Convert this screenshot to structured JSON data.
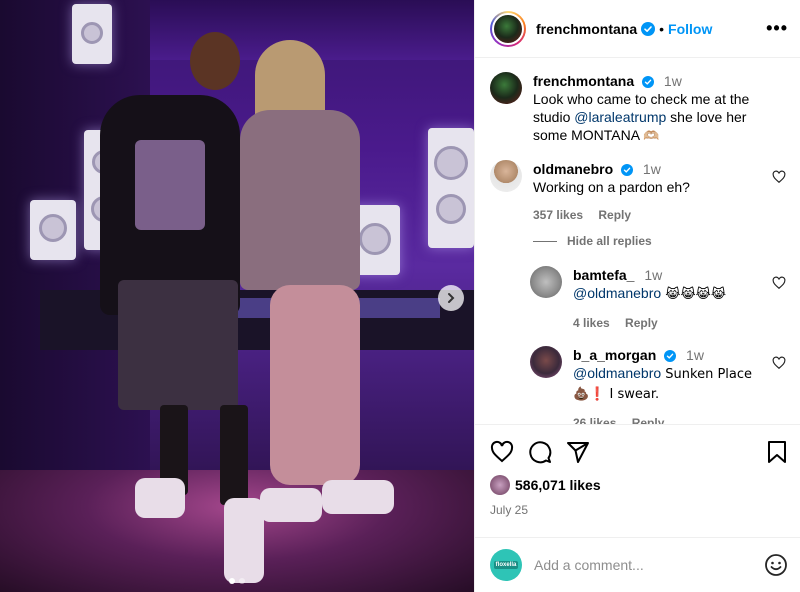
{
  "post": {
    "author": "frenchmontana",
    "follow_label": "Follow",
    "separator": "•",
    "media": {
      "slide_count": 2,
      "active_slide": 1
    }
  },
  "caption": {
    "username": "frenchmontana",
    "time": "1w",
    "text_before": "Look who came to check me at the studio ",
    "mention": "@laraleatrump",
    "text_after": " she love her some MONTANA ",
    "emoji": "🫶🏼"
  },
  "comments": [
    {
      "username": "oldmanebro",
      "verified": true,
      "time": "1w",
      "text": "Working on a pardon eh?",
      "likes": "357 likes",
      "reply_label": "Reply"
    }
  ],
  "hide_replies_label": "Hide all replies",
  "replies": [
    {
      "username": "bamtefa_",
      "time": "1w",
      "mention": "@oldmanebro",
      "text": " 😹😹😹😹",
      "likes": "4 likes",
      "reply_label": "Reply"
    },
    {
      "username": "b_a_morgan",
      "verified": true,
      "time": "1w",
      "mention": "@oldmanebro",
      "text": " Sunken Place 💩❗ I swear.",
      "likes": "26 likes",
      "reply_label": "Reply"
    }
  ],
  "footer": {
    "likes": "586,071 likes",
    "date": "July 25",
    "comment_placeholder": "Add a comment...",
    "commenter_avatar_text": "floxella"
  },
  "icons": {
    "verified": "verified-badge-icon",
    "more": "more-options-icon",
    "heart": "heart-icon",
    "comment": "comment-icon",
    "share": "share-icon",
    "bookmark": "bookmark-icon",
    "next": "chevron-right-icon",
    "emoji": "emoji-smiley-icon"
  },
  "colors": {
    "accent": "#0095f6",
    "mention": "#00376b",
    "muted": "#737373",
    "verified": "#0095f6"
  }
}
